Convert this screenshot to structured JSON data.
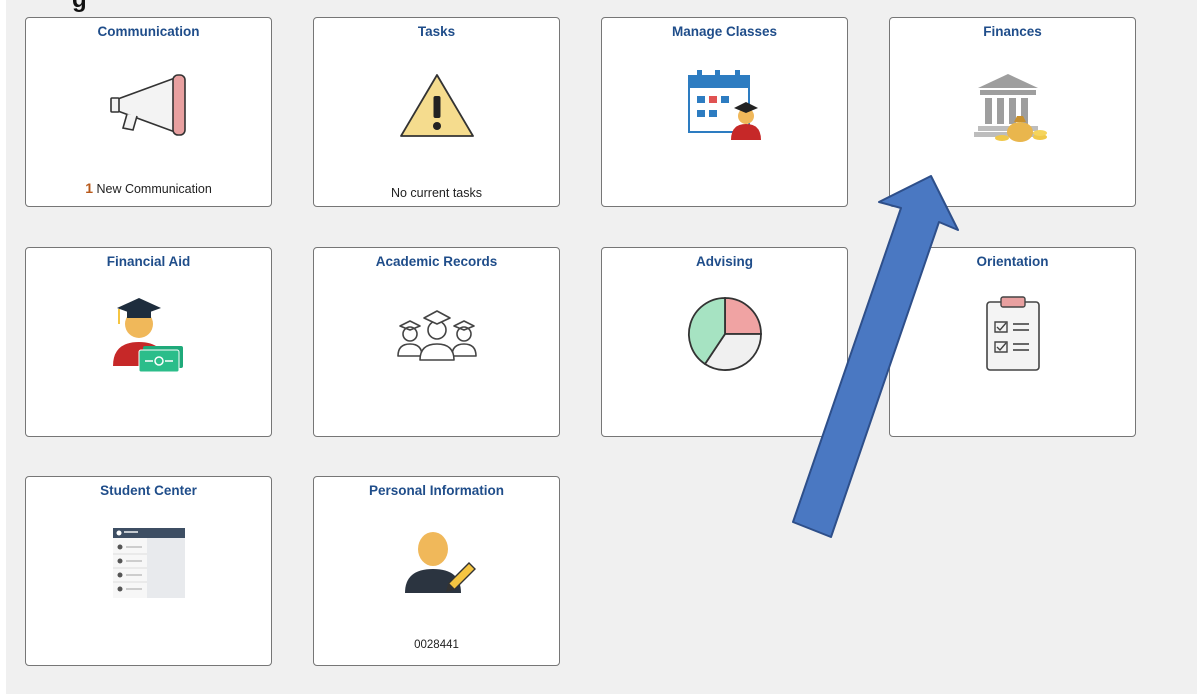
{
  "page": {
    "heading_fragment": "g"
  },
  "tiles": [
    {
      "title": "Communication",
      "icon": "megaphone-icon",
      "footer_count": "1",
      "footer_text": "New Communication"
    },
    {
      "title": "Tasks",
      "icon": "warning-icon",
      "footer_text": "No current tasks"
    },
    {
      "title": "Manage Classes",
      "icon": "calendar-student-icon"
    },
    {
      "title": "Finances",
      "icon": "bank-money-icon"
    },
    {
      "title": "Financial Aid",
      "icon": "graduate-money-icon"
    },
    {
      "title": "Academic Records",
      "icon": "graduates-group-icon"
    },
    {
      "title": "Advising",
      "icon": "pie-chart-icon"
    },
    {
      "title": "Orientation",
      "icon": "clipboard-checklist-icon"
    },
    {
      "title": "Student Center",
      "icon": "student-center-list-icon"
    },
    {
      "title": "Personal Information",
      "icon": "user-edit-icon",
      "footer_text": "0028441"
    }
  ],
  "annotation": {
    "icon": "arrow-annotation-icon",
    "color": "#4a78c2"
  }
}
